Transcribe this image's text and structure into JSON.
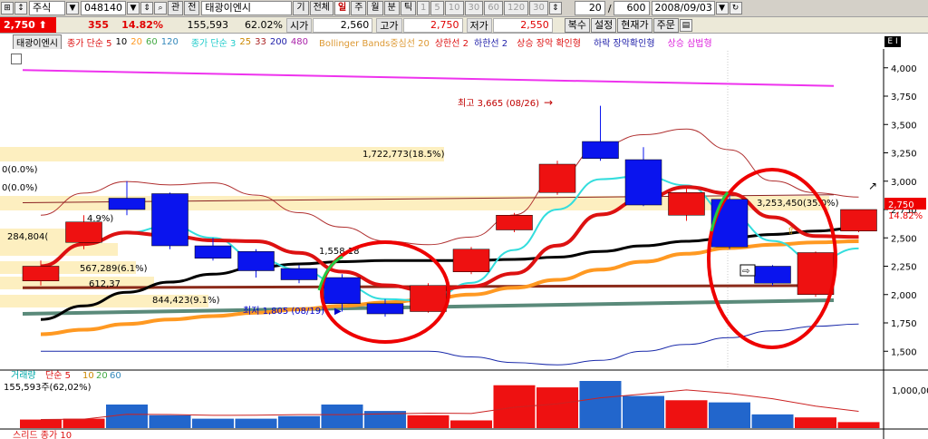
{
  "toolbar": {
    "market": "주식",
    "code": "048140",
    "chart_btn": "관",
    "all_btn": "전",
    "stock_name": "태광이엔시",
    "period_key": "기",
    "total": "전체",
    "periods": [
      "일",
      "주",
      "월",
      "분",
      "틱"
    ],
    "minutes": [
      "1",
      "5",
      "10",
      "30",
      "60",
      "120",
      "30"
    ],
    "count": "20",
    "count_total": "600",
    "date": "2008/09/03"
  },
  "quote": {
    "price": "2,750",
    "change": "355",
    "change_pct": "14.82%",
    "volume": "155,593",
    "volume_pct": "62.02%",
    "open_label": "시가",
    "open": "2,560",
    "high_label": "고가",
    "high": "2,750",
    "low_label": "저가",
    "low": "2,550",
    "buttons": [
      "복수",
      "설정",
      "현재가",
      "주문"
    ]
  },
  "legend": {
    "name": "태광이엔시",
    "close_ma": "종가 단순 5",
    "ma_periods": [
      "10",
      "20",
      "60",
      "120"
    ],
    "close_ma2": "종가 단순 3",
    "ma2_periods": [
      "25",
      "33",
      "200",
      "480"
    ],
    "bollinger": "Bollinger Bands중심선 20",
    "upper": "상한선 2",
    "lower": "하한선 2",
    "rise_confirm": "상승 장악 확인형",
    "fall_confirm": "하락 장악확인형",
    "rise_three": "상승 삼법형",
    "panel_tag": "E I"
  },
  "colors": {
    "up": "#ee1111",
    "down": "#0a14ee",
    "ma5": "#dd1111",
    "ma3": "#33dddd",
    "ma20": "#000000",
    "ma60": "#ff9922",
    "ma120": "#5a8a7a",
    "magenta": "#ee33ee",
    "band": "#b03030",
    "volume_bar": "#2266cc"
  },
  "chart_data": {
    "type": "candlestick",
    "price_axis": [
      1500,
      1750,
      2000,
      2250,
      2500,
      2750,
      3000,
      3250,
      3500,
      3750,
      4000
    ],
    "price_range": [
      1350,
      4150
    ],
    "axis_labels": [
      "4,000",
      "3,750",
      "3,500",
      "3,250",
      "3,000",
      "2,750",
      "2,500",
      "2,250",
      "2,000",
      "1,750",
      "1,500"
    ],
    "candles": [
      {
        "o": 2120,
        "c": 2250,
        "h": 2300,
        "l": 2080
      },
      {
        "o": 2460,
        "c": 2640,
        "h": 2700,
        "l": 2400
      },
      {
        "o": 2850,
        "c": 2750,
        "h": 3000,
        "l": 2700
      },
      {
        "o": 2890,
        "c": 2430,
        "h": 2900,
        "l": 2400
      },
      {
        "o": 2430,
        "c": 2320,
        "h": 2500,
        "l": 2300
      },
      {
        "o": 2380,
        "c": 2210,
        "h": 2400,
        "l": 2150
      },
      {
        "o": 2230,
        "c": 2130,
        "h": 2260,
        "l": 2100
      },
      {
        "o": 2150,
        "c": 1920,
        "h": 2180,
        "l": 1850
      },
      {
        "o": 1920,
        "c": 1830,
        "h": 1960,
        "l": 1805
      },
      {
        "o": 1850,
        "c": 2080,
        "h": 2100,
        "l": 1840
      },
      {
        "o": 2200,
        "c": 2400,
        "h": 2420,
        "l": 2180
      },
      {
        "o": 2570,
        "c": 2700,
        "h": 2720,
        "l": 2550
      },
      {
        "o": 2900,
        "c": 3150,
        "h": 3180,
        "l": 2880
      },
      {
        "o": 3350,
        "c": 3200,
        "h": 3665,
        "l": 3180
      },
      {
        "o": 3190,
        "c": 2790,
        "h": 3300,
        "l": 2780
      },
      {
        "o": 2700,
        "c": 2900,
        "h": 2950,
        "l": 2650
      },
      {
        "o": 2840,
        "c": 2420,
        "h": 2900,
        "l": 2400
      },
      {
        "o": 2250,
        "c": 2100,
        "h": 2260,
        "l": 2080
      },
      {
        "o": 2000,
        "c": 2370,
        "h": 2380,
        "l": 1980
      },
      {
        "o": 2560,
        "c": 2750,
        "h": 2750,
        "l": 2550
      }
    ],
    "volume": [
      0.2,
      0.22,
      0.55,
      0.3,
      0.22,
      0.22,
      0.28,
      0.55,
      0.4,
      0.3,
      0.18,
      1.0,
      0.95,
      1.1,
      0.75,
      0.65,
      0.6,
      0.32,
      0.25,
      0.14
    ],
    "volume_axis_label": "1,000,000",
    "annotations": {
      "high": "최고 3,665 (08/26)",
      "low": "최저 1,805 (08/19)",
      "box1": "1,722,773(18.5%)",
      "box2": "3,253,450(35.0%)",
      "box3": "284,804(",
      "box4": "4.9%)",
      "box5": "567,289(6.1%)",
      "box6": "612,37",
      "box7": "844,423(9.1%)",
      "box8": "1,558,18",
      "left1": "0(0.0%)",
      "left2": "0(0.0%)",
      "price_tag": "2,750",
      "pct_tag": "14.82%"
    },
    "volume_legend": {
      "name": "거래량",
      "ma": "단순 5",
      "p10": "10",
      "p20": "20",
      "p60": "60",
      "volume_text": "155,593주(62,02%)"
    },
    "next_panel": "스리드 종가 10"
  }
}
